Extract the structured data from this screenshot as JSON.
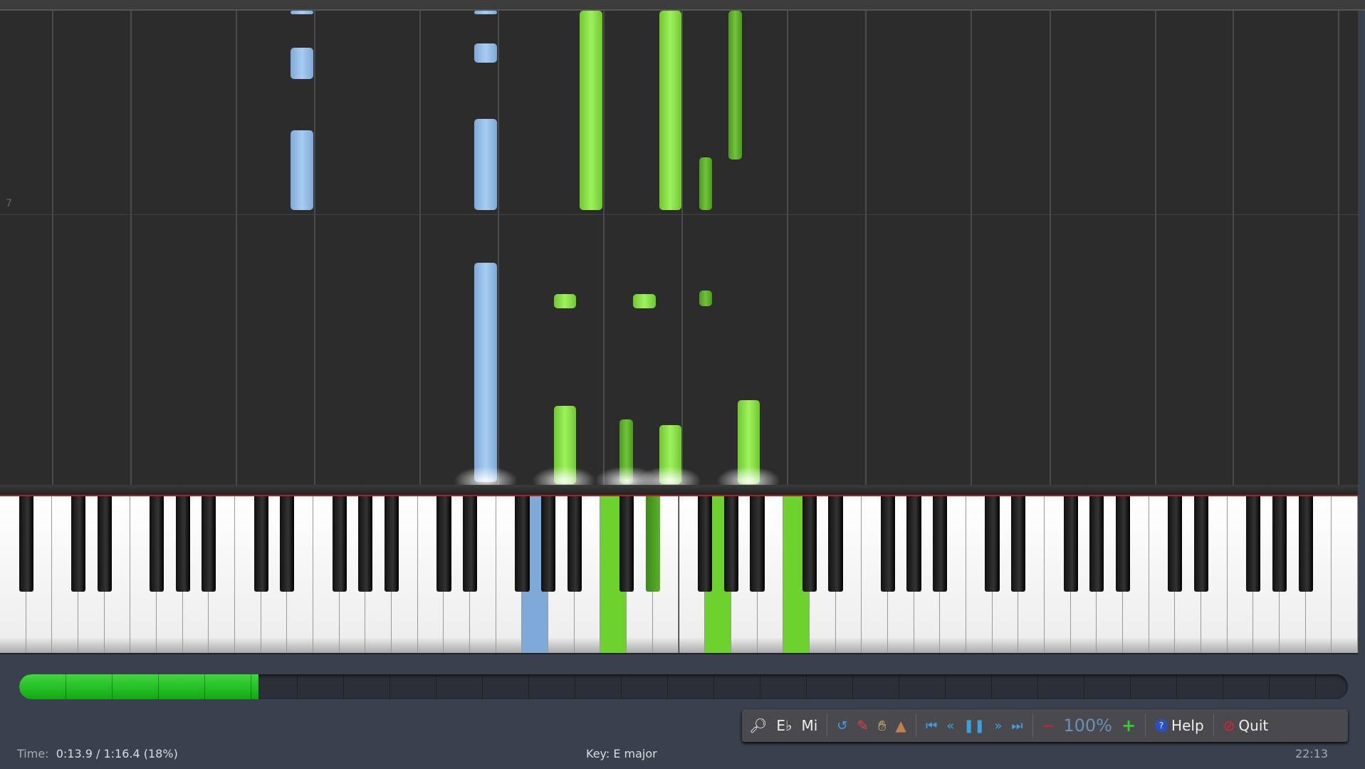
{
  "roll": {
    "measure_label": "7"
  },
  "progress": {
    "percent": 18
  },
  "toolbar": {
    "key_label": "E♭",
    "note_label": "Mi",
    "zoom": "100%",
    "help": "Help",
    "quit": "Quit"
  },
  "status": {
    "time_label": "Time:",
    "time_value": "0:13.9 / 1:16.4 (18%)",
    "key": "Key: E major",
    "clock": "22:13"
  },
  "colors": {
    "left_hand": "#8fb8e6",
    "right_hand": "#8ee04a",
    "progress": "#22c022"
  }
}
